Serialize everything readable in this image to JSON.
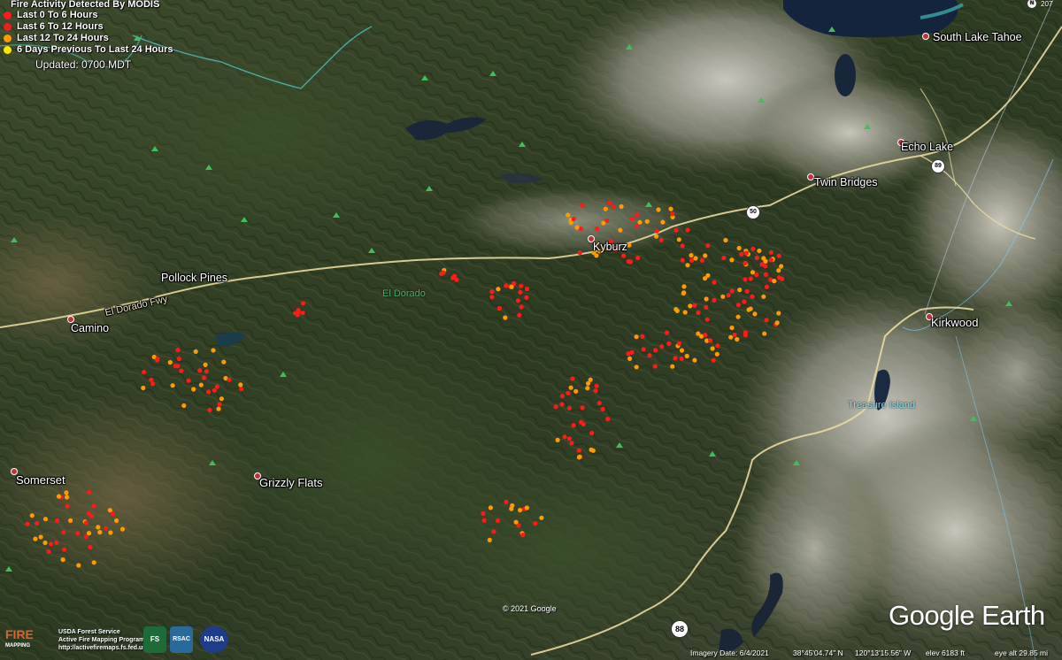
{
  "legend": {
    "title": "Fire Activity Detected By MODIS",
    "items": [
      {
        "label": "Last 0 To 6 Hours",
        "color": "#ff1a1a"
      },
      {
        "label": "Last 6 To 12 Hours",
        "color": "#e82020"
      },
      {
        "label": "Last 12 To 24 Hours",
        "color": "#ff9a00"
      },
      {
        "label": "6 Days Previous To Last 24 Hours",
        "color": "#ffe600"
      }
    ],
    "updated": "Updated: 0700 MDT"
  },
  "places": {
    "south_lake_tahoe": "South Lake Tahoe",
    "echo_lake": "Echo Lake",
    "twin_bridges": "Twin Bridges",
    "kyburz": "Kyburz",
    "pollock_pines": "Pollock Pines",
    "camino": "Camino",
    "kirkwood": "Kirkwood",
    "somerset": "Somerset",
    "grizzly_flats": "Grizzly Flats",
    "el_dorado": "El Dorado",
    "el_dorado_fwy": "El Dorado Fwy",
    "treasure_island": "Treasure Island"
  },
  "roads": {
    "us50": "50",
    "ca89": "89",
    "ca88": "88",
    "top_right": "207"
  },
  "compass": {
    "label": "N"
  },
  "footer": {
    "copyright": "© 2021 Google",
    "logo": "Google Earth",
    "imagery_date": "Imagery Date: 6/4/2021",
    "lat": "38°45'04.74\" N",
    "lon": "120°13'15.56\" W",
    "elev": "elev  6183 ft",
    "eye_alt": "eye alt  29.85 mi"
  },
  "agency": {
    "fire_top": "FIRE",
    "fire_sub": "MAPPING",
    "line1": "USDA Forest Service",
    "line2": "Active Fire Mapping Program",
    "line3": "http://activefiremaps.fs.fed.us",
    "badge_fs": "FS",
    "badge_rsac": "RSAC",
    "badge_nasa": "NASA"
  },
  "colors": {
    "terrain_dark": "#2e3d22",
    "terrain_mid": "#4a5a34",
    "rock": "#b8b6ae",
    "lake": "#1a2a44",
    "road": "#e8d9a0",
    "fire_red": "#ff1a1a",
    "fire_orange": "#ff9a00"
  }
}
